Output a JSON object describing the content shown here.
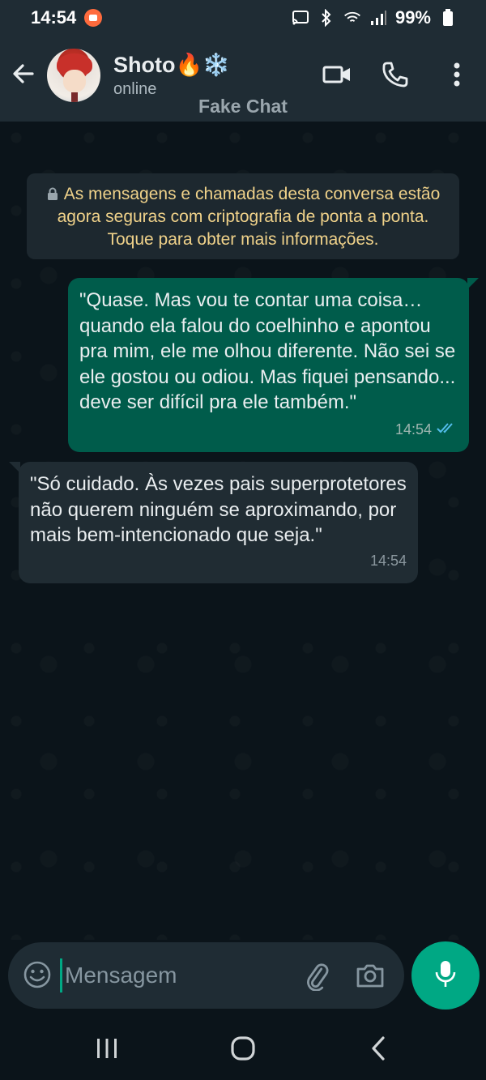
{
  "status_bar": {
    "time": "14:54",
    "battery": "99%",
    "icons": [
      "screen-record-icon",
      "cast-icon",
      "bluetooth-icon",
      "wifi-icon",
      "signal-icon",
      "battery-icon"
    ]
  },
  "header": {
    "contact_name": "Shoto🔥❄️",
    "contact_status": "online",
    "watermark": "Fake Chat",
    "icons": [
      "back-arrow-icon",
      "video-call-icon",
      "phone-icon",
      "more-options-icon"
    ]
  },
  "encryption_notice": "As mensagens e chamadas desta conversa estão agora seguras com criptografia de ponta a ponta. Toque para obter mais informações.",
  "messages": [
    {
      "direction": "outgoing",
      "text": "\"Quase. Mas vou te contar uma coisa… quando ela falou do coelhinho e apontou pra mim, ele me olhou diferente. Não sei se ele gostou ou odiou. Mas fiquei pensando... deve ser difícil pra ele também.\"",
      "time": "14:54",
      "status": "read"
    },
    {
      "direction": "incoming",
      "text": "\"Só cuidado. Às vezes pais superprotetores não querem ninguém se aproximando, por mais bem-intencionado que seja.\"",
      "time": "14:54"
    }
  ],
  "input": {
    "placeholder": "Mensagem",
    "value": ""
  },
  "colors": {
    "background": "#0b141a",
    "header": "#1f2c34",
    "outgoing_bubble": "#005c4b",
    "incoming_bubble": "#202c33",
    "accent": "#00a884",
    "read_ticks": "#53bdeb",
    "encryption_text": "#f0d28a"
  }
}
